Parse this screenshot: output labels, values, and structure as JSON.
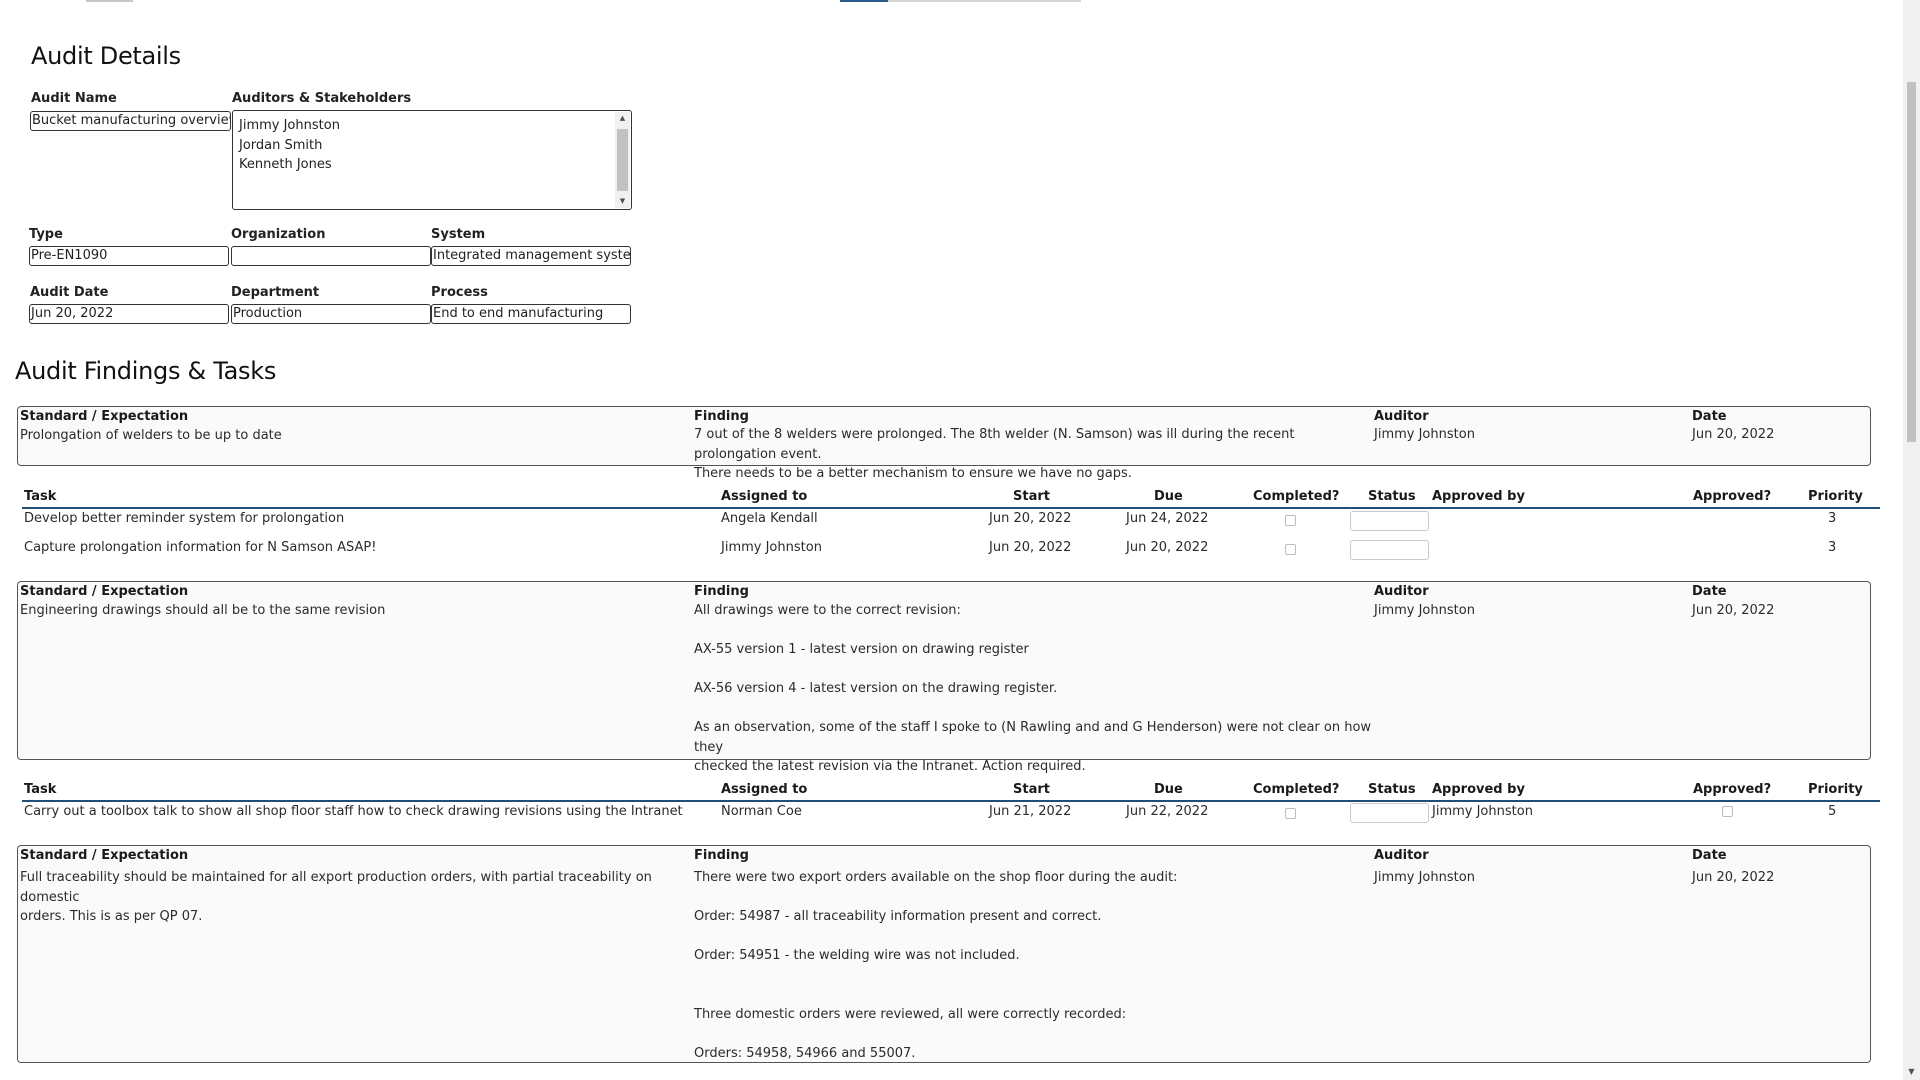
{
  "audit_details": {
    "title": "Audit Details",
    "audit_name": {
      "label": "Audit Name",
      "value": "Bucket manufacturing overview"
    },
    "auditors": {
      "label": "Auditors & Stakeholders",
      "items": [
        "Jimmy Johnston",
        "Jordan Smith",
        "Kenneth Jones"
      ]
    },
    "type": {
      "label": "Type",
      "value": "Pre-EN1090"
    },
    "organization": {
      "label": "Organization",
      "value": ""
    },
    "system": {
      "label": "System",
      "value": "Integrated management system"
    },
    "audit_date": {
      "label": "Audit Date",
      "value": "Jun 20, 2022"
    },
    "department": {
      "label": "Department",
      "value": "Production"
    },
    "process": {
      "label": "Process",
      "value": "End to end manufacturing"
    }
  },
  "findings_section": {
    "title": "Audit Findings & Tasks",
    "finding_headers": {
      "standard": "Standard / Expectation",
      "finding": "Finding",
      "auditor": "Auditor",
      "date": "Date"
    },
    "task_headers": {
      "task": "Task",
      "assigned": "Assigned to",
      "start": "Start",
      "due": "Due",
      "completed": "Completed?",
      "status": "Status",
      "approved_by": "Approved by",
      "approved": "Approved?",
      "priority": "Priority"
    },
    "findings": [
      {
        "standard": "Prolongation of welders to be up to date",
        "finding": "7 out of the 8 welders were prolonged. The 8th welder (N. Samson) was ill during the recent prolongation event.\nThere needs to be a better mechanism to ensure we have no gaps.",
        "auditor": "Jimmy Johnston",
        "date": "Jun 20, 2022",
        "tasks": [
          {
            "task": "Develop better reminder system for prolongation",
            "assigned": "Angela Kendall",
            "start": "Jun 20, 2022",
            "due": "Jun 24, 2022",
            "approved_by": "",
            "priority": "3"
          },
          {
            "task": "Capture prolongation information for N Samson ASAP!",
            "assigned": "Jimmy Johnston",
            "start": "Jun 20, 2022",
            "due": "Jun 20, 2022",
            "approved_by": "",
            "priority": "3"
          }
        ]
      },
      {
        "standard": "Engineering drawings should all be to the same revision",
        "finding": "All drawings were to the correct revision:\n\nAX-55 version 1 - latest version on drawing register\n\nAX-56 version 4 - latest version on the drawing register.\n\nAs an observation, some of the staff I spoke to (N Rawling and and G Henderson) were not clear on how they\nchecked the latest revision via the Intranet. Action required.",
        "auditor": "Jimmy Johnston",
        "date": "Jun 20, 2022",
        "tasks": [
          {
            "task": "Carry out a toolbox talk to show all shop floor staff how to check drawing revisions using the Intranet",
            "assigned": "Norman Coe",
            "start": "Jun 21, 2022",
            "due": "Jun 22, 2022",
            "approved_by": "Jimmy Johnston",
            "priority": "5"
          }
        ]
      },
      {
        "standard": "Full traceability should be maintained for all export production orders, with partial traceability on domestic\norders. This is as per QP 07.",
        "finding": "There were two export orders available on the shop floor during the audit:\n\nOrder: 54987 - all traceability information present and correct.\n\nOrder: 54951 - the welding wire was not included.\n\n\nThree domestic orders were reviewed, all were correctly recorded:\n\nOrders: 54958, 54966 and 55007.",
        "auditor": "Jimmy Johnston",
        "date": "Jun 20, 2022",
        "tasks": []
      }
    ]
  }
}
